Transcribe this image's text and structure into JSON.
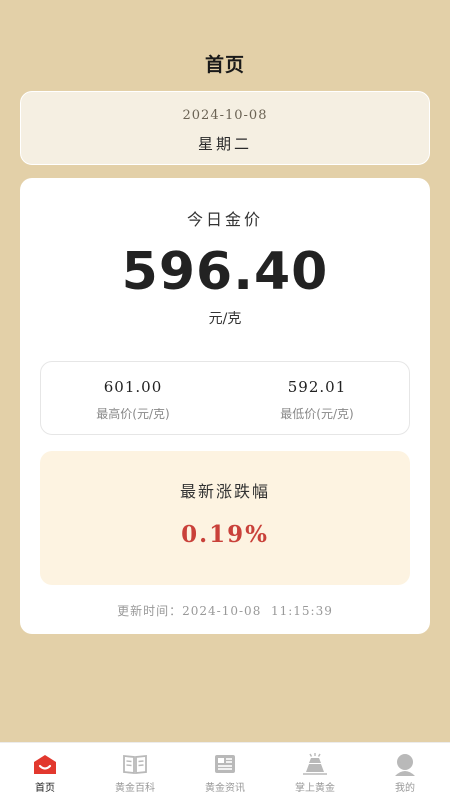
{
  "header": {
    "title": "首页"
  },
  "date_card": {
    "date": "2024-10-08",
    "weekday": "星期二"
  },
  "price_card": {
    "label": "今日金价",
    "price": "596.40",
    "unit": "元/克",
    "high": {
      "value": "601.00",
      "label": "最高价(元/克)"
    },
    "low": {
      "value": "592.01",
      "label": "最低价(元/克)"
    },
    "change": {
      "label": "最新涨跌幅",
      "value": "0.19%"
    },
    "updated": {
      "prefix": "更新时间：",
      "time": "2024-10-08  11:15:39"
    }
  },
  "colors": {
    "background": "#e3d0a8",
    "accent": "#e2382e",
    "change": "#c9413a"
  },
  "tabbar": {
    "items": [
      {
        "label": "首页",
        "icon": "home-icon",
        "active": true
      },
      {
        "label": "黄金百科",
        "icon": "book-icon",
        "active": false
      },
      {
        "label": "黄金资讯",
        "icon": "news-icon",
        "active": false
      },
      {
        "label": "掌上黄金",
        "icon": "gold-bar-icon",
        "active": false
      },
      {
        "label": "我的",
        "icon": "profile-icon",
        "active": false
      }
    ]
  }
}
